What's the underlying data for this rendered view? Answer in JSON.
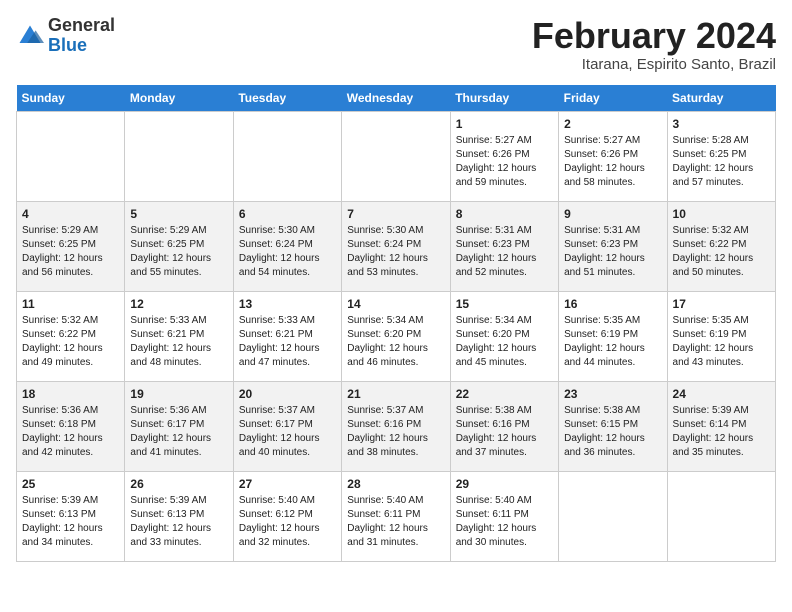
{
  "header": {
    "logo_general": "General",
    "logo_blue": "Blue",
    "month_title": "February 2024",
    "location": "Itarana, Espirito Santo, Brazil"
  },
  "days_of_week": [
    "Sunday",
    "Monday",
    "Tuesday",
    "Wednesday",
    "Thursday",
    "Friday",
    "Saturday"
  ],
  "weeks": [
    [
      {
        "day": "",
        "info": ""
      },
      {
        "day": "",
        "info": ""
      },
      {
        "day": "",
        "info": ""
      },
      {
        "day": "",
        "info": ""
      },
      {
        "day": "1",
        "info": "Sunrise: 5:27 AM\nSunset: 6:26 PM\nDaylight: 12 hours and 59 minutes."
      },
      {
        "day": "2",
        "info": "Sunrise: 5:27 AM\nSunset: 6:26 PM\nDaylight: 12 hours and 58 minutes."
      },
      {
        "day": "3",
        "info": "Sunrise: 5:28 AM\nSunset: 6:25 PM\nDaylight: 12 hours and 57 minutes."
      }
    ],
    [
      {
        "day": "4",
        "info": "Sunrise: 5:29 AM\nSunset: 6:25 PM\nDaylight: 12 hours and 56 minutes."
      },
      {
        "day": "5",
        "info": "Sunrise: 5:29 AM\nSunset: 6:25 PM\nDaylight: 12 hours and 55 minutes."
      },
      {
        "day": "6",
        "info": "Sunrise: 5:30 AM\nSunset: 6:24 PM\nDaylight: 12 hours and 54 minutes."
      },
      {
        "day": "7",
        "info": "Sunrise: 5:30 AM\nSunset: 6:24 PM\nDaylight: 12 hours and 53 minutes."
      },
      {
        "day": "8",
        "info": "Sunrise: 5:31 AM\nSunset: 6:23 PM\nDaylight: 12 hours and 52 minutes."
      },
      {
        "day": "9",
        "info": "Sunrise: 5:31 AM\nSunset: 6:23 PM\nDaylight: 12 hours and 51 minutes."
      },
      {
        "day": "10",
        "info": "Sunrise: 5:32 AM\nSunset: 6:22 PM\nDaylight: 12 hours and 50 minutes."
      }
    ],
    [
      {
        "day": "11",
        "info": "Sunrise: 5:32 AM\nSunset: 6:22 PM\nDaylight: 12 hours and 49 minutes."
      },
      {
        "day": "12",
        "info": "Sunrise: 5:33 AM\nSunset: 6:21 PM\nDaylight: 12 hours and 48 minutes."
      },
      {
        "day": "13",
        "info": "Sunrise: 5:33 AM\nSunset: 6:21 PM\nDaylight: 12 hours and 47 minutes."
      },
      {
        "day": "14",
        "info": "Sunrise: 5:34 AM\nSunset: 6:20 PM\nDaylight: 12 hours and 46 minutes."
      },
      {
        "day": "15",
        "info": "Sunrise: 5:34 AM\nSunset: 6:20 PM\nDaylight: 12 hours and 45 minutes."
      },
      {
        "day": "16",
        "info": "Sunrise: 5:35 AM\nSunset: 6:19 PM\nDaylight: 12 hours and 44 minutes."
      },
      {
        "day": "17",
        "info": "Sunrise: 5:35 AM\nSunset: 6:19 PM\nDaylight: 12 hours and 43 minutes."
      }
    ],
    [
      {
        "day": "18",
        "info": "Sunrise: 5:36 AM\nSunset: 6:18 PM\nDaylight: 12 hours and 42 minutes."
      },
      {
        "day": "19",
        "info": "Sunrise: 5:36 AM\nSunset: 6:17 PM\nDaylight: 12 hours and 41 minutes."
      },
      {
        "day": "20",
        "info": "Sunrise: 5:37 AM\nSunset: 6:17 PM\nDaylight: 12 hours and 40 minutes."
      },
      {
        "day": "21",
        "info": "Sunrise: 5:37 AM\nSunset: 6:16 PM\nDaylight: 12 hours and 38 minutes."
      },
      {
        "day": "22",
        "info": "Sunrise: 5:38 AM\nSunset: 6:16 PM\nDaylight: 12 hours and 37 minutes."
      },
      {
        "day": "23",
        "info": "Sunrise: 5:38 AM\nSunset: 6:15 PM\nDaylight: 12 hours and 36 minutes."
      },
      {
        "day": "24",
        "info": "Sunrise: 5:39 AM\nSunset: 6:14 PM\nDaylight: 12 hours and 35 minutes."
      }
    ],
    [
      {
        "day": "25",
        "info": "Sunrise: 5:39 AM\nSunset: 6:13 PM\nDaylight: 12 hours and 34 minutes."
      },
      {
        "day": "26",
        "info": "Sunrise: 5:39 AM\nSunset: 6:13 PM\nDaylight: 12 hours and 33 minutes."
      },
      {
        "day": "27",
        "info": "Sunrise: 5:40 AM\nSunset: 6:12 PM\nDaylight: 12 hours and 32 minutes."
      },
      {
        "day": "28",
        "info": "Sunrise: 5:40 AM\nSunset: 6:11 PM\nDaylight: 12 hours and 31 minutes."
      },
      {
        "day": "29",
        "info": "Sunrise: 5:40 AM\nSunset: 6:11 PM\nDaylight: 12 hours and 30 minutes."
      },
      {
        "day": "",
        "info": ""
      },
      {
        "day": "",
        "info": ""
      }
    ]
  ]
}
